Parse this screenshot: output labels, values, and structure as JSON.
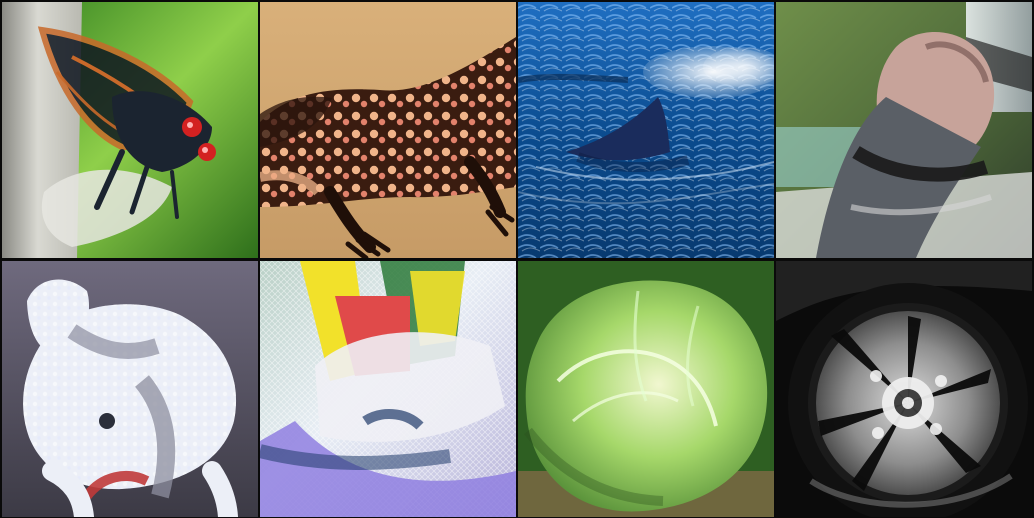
{
  "grid": {
    "tiles": [
      {
        "subject": "cicada",
        "palette": [
          "#2f7d1f",
          "#8fcf4a",
          "#1b2430",
          "#c8692a",
          "#d9d9d2"
        ]
      },
      {
        "subject": "gila-monster",
        "palette": [
          "#d9b07a",
          "#3a1c10",
          "#f0b48a",
          "#e2826c"
        ]
      },
      {
        "subject": "whale",
        "palette": [
          "#0a4a8c",
          "#1f6fc2",
          "#1a2c5c",
          "#e8f2ff"
        ]
      },
      {
        "subject": "person-holding-animal",
        "palette": [
          "#6f8f4a",
          "#c7a39a",
          "#5a5f66",
          "#1a1a1a",
          "#e9eef0"
        ]
      },
      {
        "subject": "bedlington-terrier",
        "palette": [
          "#8d8f9f",
          "#eceff7",
          "#2b2f3a",
          "#c03a3a"
        ]
      },
      {
        "subject": "abstract-object",
        "palette": [
          "#f2e12a",
          "#e04a4a",
          "#1f3a6a",
          "#8f7fe0",
          "#f0f0f5"
        ]
      },
      {
        "subject": "cabbage",
        "palette": [
          "#3f7a2a",
          "#a6d86a",
          "#f1f7d0",
          "#8b6b4a"
        ]
      },
      {
        "subject": "wheel",
        "palette": [
          "#0b0b0b",
          "#2b2b2b",
          "#9a9a9a",
          "#f2f2f2"
        ]
      }
    ]
  }
}
